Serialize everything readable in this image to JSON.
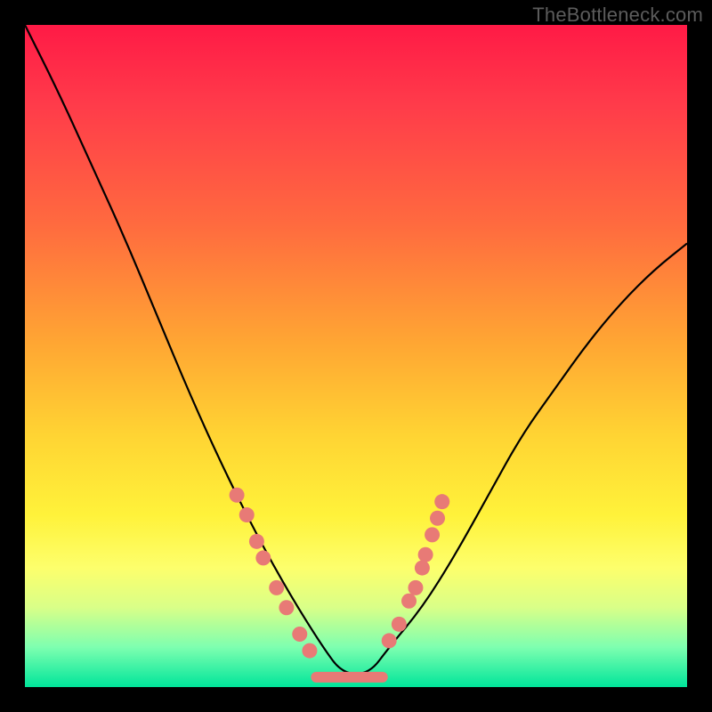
{
  "watermark": "TheBottleneck.com",
  "chart_data": {
    "type": "line",
    "title": "",
    "xlabel": "",
    "ylabel": "",
    "xlim": [
      0,
      100
    ],
    "ylim": [
      0,
      100
    ],
    "note": "V-shaped bottleneck curve on a vertical red→green gradient. Values are the approximate curve height (0 = bottom/green/optimal, 100 = top/red/severe bottleneck) at each x position, read from the image.",
    "series": [
      {
        "name": "bottleneck-curve",
        "x": [
          0,
          5,
          10,
          15,
          20,
          25,
          30,
          35,
          40,
          45,
          48,
          52,
          55,
          60,
          65,
          70,
          75,
          80,
          85,
          90,
          95,
          100
        ],
        "values": [
          100,
          90,
          79,
          68,
          56,
          44,
          33,
          23,
          14,
          6,
          2,
          2,
          6,
          12,
          20,
          29,
          38,
          45,
          52,
          58,
          63,
          67
        ]
      }
    ],
    "markers": {
      "note": "Salmon-colored dots clustered on the descending and ascending arms near the trough, plus a flat salmon segment at the very bottom.",
      "left_arm": [
        {
          "x": 32,
          "y": 29
        },
        {
          "x": 33.5,
          "y": 26
        },
        {
          "x": 35,
          "y": 22
        },
        {
          "x": 36,
          "y": 19.5
        },
        {
          "x": 38,
          "y": 15
        },
        {
          "x": 39.5,
          "y": 12
        },
        {
          "x": 41.5,
          "y": 8
        },
        {
          "x": 43,
          "y": 5.5
        }
      ],
      "right_arm": [
        {
          "x": 55,
          "y": 7
        },
        {
          "x": 56.5,
          "y": 9.5
        },
        {
          "x": 58,
          "y": 13
        },
        {
          "x": 59,
          "y": 15
        },
        {
          "x": 60,
          "y": 18
        },
        {
          "x": 60.5,
          "y": 20
        },
        {
          "x": 61.5,
          "y": 23
        },
        {
          "x": 62.3,
          "y": 25.5
        },
        {
          "x": 63,
          "y": 28
        }
      ],
      "flat_segment": {
        "x_start": 44,
        "x_end": 54,
        "y": 1.5
      }
    },
    "gradient_stops": [
      {
        "pos": 0,
        "color": "#ff1a46"
      },
      {
        "pos": 30,
        "color": "#ff6a3f"
      },
      {
        "pos": 62,
        "color": "#ffd433"
      },
      {
        "pos": 82,
        "color": "#fdff6c"
      },
      {
        "pos": 100,
        "color": "#00e59a"
      }
    ]
  }
}
